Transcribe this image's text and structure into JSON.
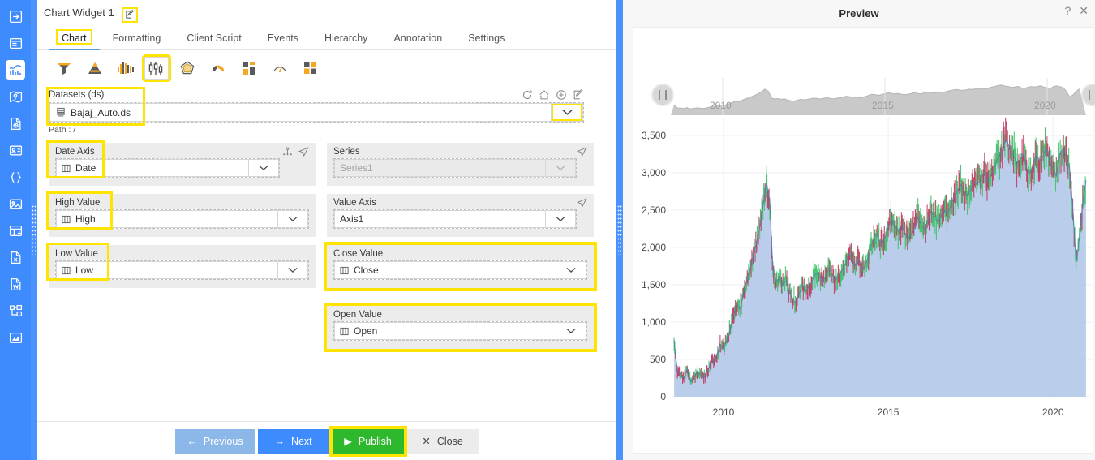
{
  "app": {
    "rail_items": [
      {
        "name": "sidebar-item-export",
        "icon": "arrow-into-box-icon"
      },
      {
        "name": "sidebar-item-dashboard",
        "icon": "panel-card-icon"
      },
      {
        "name": "sidebar-item-chart-widget",
        "icon": "bar-line-chart-icon",
        "active": true
      },
      {
        "name": "sidebar-item-map",
        "icon": "map-pin-icon"
      },
      {
        "name": "sidebar-item-report",
        "icon": "document-clock-icon"
      },
      {
        "name": "sidebar-item-profile-card",
        "icon": "id-card-icon"
      },
      {
        "name": "sidebar-item-code",
        "icon": "curly-braces-icon"
      },
      {
        "name": "sidebar-item-image",
        "icon": "picture-icon"
      },
      {
        "name": "sidebar-item-table",
        "icon": "table-grid-icon"
      },
      {
        "name": "sidebar-item-excel",
        "icon": "excel-file-icon"
      },
      {
        "name": "sidebar-item-word",
        "icon": "word-file-icon"
      },
      {
        "name": "sidebar-item-hierarchy",
        "icon": "hierarchy-tree-icon"
      },
      {
        "name": "sidebar-item-analytics",
        "icon": "area-chart-icon"
      }
    ]
  },
  "window": {
    "title": "Chart Widget 1",
    "edit_title_icon": "pencil-square-icon",
    "help_icon": "?",
    "close_icon": "✕"
  },
  "tabs": [
    {
      "label": "Chart",
      "active": true
    },
    {
      "label": "Formatting",
      "active": false
    },
    {
      "label": "Client Script",
      "active": false
    },
    {
      "label": "Events",
      "active": false
    },
    {
      "label": "Hierarchy",
      "active": false
    },
    {
      "label": "Annotation",
      "active": false
    },
    {
      "label": "Settings",
      "active": false
    }
  ],
  "chart_types": [
    {
      "name": "chart-type-funnel",
      "icon": "funnel-icon",
      "selected": false
    },
    {
      "name": "chart-type-pyramid",
      "icon": "pyramid-icon",
      "selected": false
    },
    {
      "name": "chart-type-histogram",
      "icon": "histogram-icon",
      "selected": false
    },
    {
      "name": "chart-type-candlestick",
      "icon": "candlestick-icon",
      "selected": true
    },
    {
      "name": "chart-type-radar",
      "icon": "radar-polygon-icon",
      "selected": false
    },
    {
      "name": "chart-type-gauge-arc",
      "icon": "gauge-arc-icon",
      "selected": false
    },
    {
      "name": "chart-type-treemap",
      "icon": "treemap-icon",
      "selected": false
    },
    {
      "name": "chart-type-dial-gauge",
      "icon": "dial-gauge-icon",
      "selected": false
    },
    {
      "name": "chart-type-tiles",
      "icon": "tiles-icon",
      "selected": false
    }
  ],
  "datasets": {
    "label": "Datasets (ds)",
    "value": "Bajaj_Auto.ds",
    "value_icon": "dataset-stack-icon",
    "path_note": "Path : /",
    "tools": [
      {
        "name": "refresh-dataset-icon"
      },
      {
        "name": "home-icon"
      },
      {
        "name": "add-dataset-icon"
      },
      {
        "name": "edit-dataset-icon"
      }
    ]
  },
  "fields": {
    "date_axis": {
      "label": "Date Axis",
      "value": "Date",
      "placeholder": "",
      "disabled": false
    },
    "series": {
      "label": "Series",
      "value": "",
      "placeholder": "Series1",
      "disabled": true
    },
    "high_value": {
      "label": "High Value",
      "value": "High",
      "placeholder": "",
      "disabled": false
    },
    "value_axis": {
      "label": "Value Axis",
      "value": "Axis1",
      "placeholder": "",
      "disabled": false
    },
    "low_value": {
      "label": "Low Value",
      "value": "Low",
      "placeholder": "",
      "disabled": false
    },
    "close_value": {
      "label": "Close Value",
      "value": "Close",
      "placeholder": "",
      "disabled": false
    },
    "open_value": {
      "label": "Open Value",
      "value": "Open",
      "placeholder": "",
      "disabled": false
    }
  },
  "footer": {
    "previous_label": "Previous",
    "next_label": "Next",
    "publish_label": "Publish",
    "close_label": "Close"
  },
  "preview": {
    "title": "Preview"
  },
  "colors": {
    "accent_blue": "#3d8bfd",
    "highlight_yellow": "#ffe400",
    "publish_green": "#2eb82e",
    "area_fill": "#aec6e8",
    "candle_up": "#3ec26a",
    "candle_down": "#c0395f"
  },
  "chart_data": {
    "type": "line",
    "title": "",
    "xlabel": "",
    "ylabel": "",
    "xticks": [
      "2010",
      "2015",
      "2020"
    ],
    "yticks": [
      "0",
      "500",
      "1,000",
      "1,500",
      "2,000",
      "2,500",
      "3,000",
      "3,500"
    ],
    "ylim": [
      0,
      3750
    ],
    "xlim": [
      2008.4,
      2021.2
    ],
    "grid": true,
    "legend": "none",
    "navigator": {
      "xticks": [
        "2010",
        "2015",
        "2020"
      ],
      "range_start": "2008",
      "range_end": "2021"
    },
    "series": [
      {
        "name": "Close",
        "x": [
          2008.5,
          2008.6,
          2008.7,
          2008.8,
          2008.9,
          2009.0,
          2009.1,
          2009.2,
          2009.3,
          2009.4,
          2009.5,
          2009.6,
          2009.7,
          2009.8,
          2009.9,
          2010.0,
          2010.1,
          2010.2,
          2010.3,
          2010.4,
          2010.5,
          2010.6,
          2010.7,
          2010.8,
          2010.9,
          2011.0,
          2011.1,
          2011.2,
          2011.3,
          2011.4,
          2011.5,
          2011.6,
          2011.7,
          2011.8,
          2011.9,
          2012.0,
          2012.1,
          2012.2,
          2012.3,
          2012.4,
          2012.5,
          2012.6,
          2012.7,
          2012.8,
          2012.9,
          2013.0,
          2013.1,
          2013.2,
          2013.3,
          2013.4,
          2013.5,
          2013.6,
          2013.7,
          2013.8,
          2013.9,
          2014.0,
          2014.1,
          2014.2,
          2014.3,
          2014.4,
          2014.5,
          2014.6,
          2014.7,
          2014.8,
          2014.9,
          2015.0,
          2015.1,
          2015.2,
          2015.3,
          2015.4,
          2015.5,
          2015.6,
          2015.7,
          2015.8,
          2015.9,
          2016.0,
          2016.1,
          2016.2,
          2016.3,
          2016.4,
          2016.5,
          2016.6,
          2016.7,
          2016.8,
          2016.9,
          2017.0,
          2017.1,
          2017.2,
          2017.3,
          2017.4,
          2017.5,
          2017.6,
          2017.7,
          2017.8,
          2017.9,
          2018.0,
          2018.1,
          2018.2,
          2018.3,
          2018.4,
          2018.5,
          2018.6,
          2018.7,
          2018.8,
          2018.9,
          2019.0,
          2019.1,
          2019.2,
          2019.3,
          2019.4,
          2019.5,
          2019.6,
          2019.7,
          2019.8,
          2019.9,
          2020.0,
          2020.1,
          2020.2,
          2020.3,
          2020.4,
          2020.5,
          2020.6,
          2020.7,
          2020.8,
          2020.9,
          2021.0
        ],
        "y": [
          760,
          330,
          300,
          250,
          370,
          200,
          260,
          330,
          300,
          250,
          330,
          440,
          480,
          560,
          700,
          640,
          760,
          900,
          1080,
          1240,
          1180,
          1380,
          1560,
          1700,
          1880,
          2060,
          2280,
          2560,
          2880,
          2640,
          1700,
          1540,
          1600,
          1500,
          1560,
          1400,
          1300,
          1260,
          1380,
          1500,
          1420,
          1480,
          1560,
          1660,
          1620,
          1540,
          1620,
          1720,
          1640,
          1560,
          1620,
          1700,
          1780,
          1920,
          1860,
          1760,
          1840,
          1700,
          1760,
          1880,
          2040,
          2180,
          2120,
          2040,
          2140,
          2260,
          2380,
          2300,
          2220,
          2300,
          2200,
          2120,
          2180,
          2260,
          2400,
          2300,
          2240,
          2360,
          2480,
          2420,
          2340,
          2420,
          2500,
          2460,
          2560,
          2680,
          2760,
          2840,
          2760,
          2700,
          2780,
          2880,
          2840,
          2920,
          3000,
          2880,
          2960,
          3040,
          3180,
          3260,
          3380,
          3440,
          3300,
          3240,
          3120,
          3180,
          3260,
          3060,
          3000,
          3120,
          3240,
          3160,
          3240,
          3340,
          3160,
          3060,
          2960,
          3240,
          3320,
          3220,
          3060,
          2540,
          1800,
          2120,
          2600,
          2900,
          3100,
          3260,
          3180,
          3000,
          3140
        ]
      }
    ]
  }
}
